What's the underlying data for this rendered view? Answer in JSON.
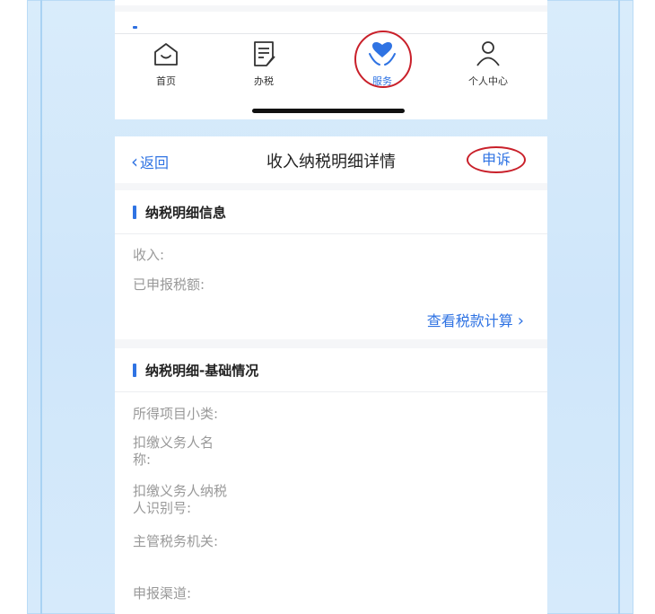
{
  "tabbar": {
    "home_label": "首页",
    "tax_label": "办税",
    "service_label": "服务",
    "me_label": "个人中心"
  },
  "navbar": {
    "back_label": "返回",
    "title": "收入纳税明细详情",
    "appeal_label": "申诉"
  },
  "section1": {
    "title": "纳税明细信息",
    "income_label": "收入:",
    "declared_tax_label": "已申报税额:",
    "calc_link": "查看税款计算"
  },
  "section2": {
    "title": "纳税明细-基础情况",
    "fields": [
      {
        "line1": "所得项目小类:",
        "line2": ""
      },
      {
        "line1": "扣缴义务人名",
        "line2": "称:"
      },
      {
        "line1": "扣缴义务人纳税",
        "line2": "人识别号:"
      },
      {
        "line1": "主管税务机关:",
        "line2": ""
      },
      {
        "line1": "申报渠道:",
        "line2": ""
      }
    ]
  },
  "colors": {
    "accent": "#2f73e3",
    "annotation_red": "#c9202a",
    "label_gray": "#999999",
    "background_blue": "#d4e9fb"
  },
  "icons": {
    "home": "home-icon",
    "tax": "tax-document-icon",
    "service": "heart-hands-icon",
    "me": "person-icon",
    "back": "chevron-left-icon",
    "calc_arrow": "chevron-right-icon"
  }
}
